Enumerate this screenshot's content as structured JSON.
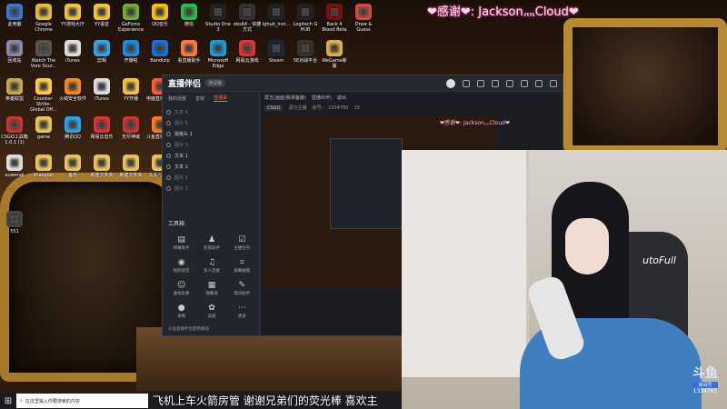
{
  "banner": {
    "text": "❤感谢❤: Jackson灬Cloud❤"
  },
  "sub_banner": {
    "text": "❤感谢❤: Jackson灬Cloud❤"
  },
  "desktop_icons": [
    {
      "label": "此电脑",
      "icon": "computer-icon",
      "color": "#3a78c9"
    },
    {
      "label": "Google Chrome",
      "icon": "chrome-icon",
      "color": "#e8b93a"
    },
    {
      "label": "YY游戏大厅",
      "icon": "yy-game-icon",
      "color": "#f6c23c"
    },
    {
      "label": "YY语音",
      "icon": "yy-voice-icon",
      "color": "#f6c23c"
    },
    {
      "label": "GeForce Experience",
      "icon": "nvidia-icon",
      "color": "#6fb02a"
    },
    {
      "label": "QQ音乐",
      "icon": "qq-music-icon",
      "color": "#f5c400"
    },
    {
      "label": "微信",
      "icon": "wechat-icon",
      "color": "#2fb84b"
    },
    {
      "label": "Studio One 3",
      "icon": "studio-one-icon",
      "color": "#222"
    },
    {
      "label": "obs64 - 快捷方式",
      "icon": "obs-icon",
      "color": "#333"
    },
    {
      "label": "lghub_inst...",
      "icon": "lghub-icon",
      "color": "#222"
    },
    {
      "label": "Logitech G HUB",
      "icon": "logitech-icon",
      "color": "#222"
    },
    {
      "label": "Back 4 Blood Beta",
      "icon": "b4b-icon",
      "color": "#7a1010"
    },
    {
      "label": "Draw & Guess",
      "icon": "draw-guess-icon",
      "color": "#c94d3a"
    },
    {
      "label": "回收站",
      "icon": "recycle-bin-icon",
      "color": "#88a"
    },
    {
      "label": "Watch The Vore Sour...",
      "icon": "game-icon",
      "color": "#555"
    },
    {
      "label": "iTunes",
      "icon": "itunes-icon",
      "color": "#ddd"
    },
    {
      "label": "剪辑",
      "icon": "edit-icon",
      "color": "#3aa0e8"
    },
    {
      "label": "开播啦",
      "icon": "live-icon",
      "color": "#1f8ae0"
    },
    {
      "label": "Bandizip",
      "icon": "bandizip-icon",
      "color": "#1e6fd0"
    },
    {
      "label": "看直播助手",
      "icon": "watch-icon",
      "color": "#ff7a3a"
    },
    {
      "label": "Microsoft Edge",
      "icon": "edge-icon",
      "color": "#1f9ad6"
    },
    {
      "label": "网易云游戏",
      "icon": "netease-icon",
      "color": "#d93535"
    },
    {
      "label": "Steam",
      "icon": "steam-icon",
      "color": "#1b2838"
    },
    {
      "label": "5E对战平台",
      "icon": "5e-icon",
      "color": "#333"
    },
    {
      "label": "WeGame新版",
      "icon": "wegame-icon",
      "color": "#d8b04a"
    },
    {
      "label": "英雄联盟",
      "icon": "lol-icon",
      "color": "#c8a848"
    },
    {
      "label": "Counter-Strike: Global Off...",
      "icon": "csgo-icon",
      "color": "#ffcc44"
    },
    {
      "label": "火绒安全软件",
      "icon": "huorong-icon",
      "color": "#f08a24"
    },
    {
      "label": "iTunes",
      "icon": "itunes-icon",
      "color": "#ddd"
    },
    {
      "label": "YY开播",
      "icon": "yy-live-icon",
      "color": "#f6c23c"
    },
    {
      "label": "电脑直播助手",
      "icon": "pc-live-icon",
      "color": "#ff5a3a"
    },
    {
      "label": "CSGO工具箱 1.0.1 (1)",
      "icon": "csgo-tool-icon",
      "color": "#c33"
    },
    {
      "label": "game",
      "icon": "folder-icon",
      "color": "#e6c35a"
    },
    {
      "label": "腾讯QQ",
      "icon": "qq-icon",
      "color": "#2aa3ef"
    },
    {
      "label": "网易云音乐",
      "icon": "netease-music-icon",
      "color": "#d93535"
    },
    {
      "label": "无尽神域",
      "icon": "game2-icon",
      "color": "#c33"
    },
    {
      "label": "斗鱼直播伴侣",
      "icon": "douyu-icon",
      "color": "#ff7a20"
    },
    {
      "label": "auwenqi",
      "icon": "file-icon",
      "color": "#ddd"
    },
    {
      "label": "zhaopian",
      "icon": "folder-icon",
      "color": "#e6c35a"
    },
    {
      "label": "备份",
      "icon": "folder-icon",
      "color": "#e6c35a"
    },
    {
      "label": "新建文件夹",
      "icon": "folder-icon",
      "color": "#e6c35a"
    },
    {
      "label": "新建文件夹",
      "icon": "folder-icon",
      "color": "#e6c35a"
    },
    {
      "label": "文本与资源",
      "icon": "folder-icon",
      "color": "#e6c35a"
    },
    {
      "label": "551",
      "icon": "file-icon",
      "color": "#444"
    }
  ],
  "app": {
    "title": "直播伴侣",
    "version": "测试版",
    "left_tabs": [
      "我的场景",
      "音效",
      "直播桌"
    ],
    "sources": [
      {
        "label": "文本 4",
        "visible": false
      },
      {
        "label": "图片 5",
        "visible": false
      },
      {
        "label": "摄像头 1",
        "visible": true
      },
      {
        "label": "图片 3",
        "visible": false
      },
      {
        "label": "文本 1",
        "visible": true
      },
      {
        "label": "文本 2",
        "visible": true
      },
      {
        "label": "图片 2",
        "visible": false
      },
      {
        "label": "图片 1",
        "visible": false
      }
    ],
    "toolbox_title": "工具箱",
    "tools": [
      {
        "label": "弹幕助手",
        "icon": "barrage-icon"
      },
      {
        "label": "房管助手",
        "icon": "admin-icon"
      },
      {
        "label": "主播任务",
        "icon": "task-icon"
      },
      {
        "label": "视频语音",
        "icon": "video-call-icon"
      },
      {
        "label": "多人连麦",
        "icon": "multi-call-icon"
      },
      {
        "label": "屏幕截图",
        "icon": "screenshot-icon"
      },
      {
        "label": "虚拟形象",
        "icon": "avatar-icon"
      },
      {
        "label": "弹幕墙",
        "icon": "wall-icon"
      },
      {
        "label": "歌词助手",
        "icon": "lyrics-icon"
      },
      {
        "label": "录制",
        "icon": "record-icon"
      },
      {
        "label": "美颜",
        "icon": "beauty-icon"
      },
      {
        "label": "更多",
        "icon": "more-icon"
      }
    ],
    "notice": "斗鱼直播伴侣使用教程",
    "right_tabs": [
      "屏五(画面)我准备撤)",
      "直播伙伴)",
      "退出"
    ],
    "info": {
      "category": "CSGO",
      "tag": "清分主播",
      "room_label": "房号:",
      "room_id": "1334765",
      "online": "13"
    },
    "bottom_actions": [
      {
        "label": "直播屏幕",
        "icon": "screen-icon"
      },
      {
        "label": "摄像头",
        "icon": "camera-icon"
      },
      {
        "label": "手机投屏",
        "icon": "phone-icon"
      },
      {
        "label": "多媒体",
        "icon": "media-icon"
      }
    ]
  },
  "webcam": {
    "chair_brand": "utoFull",
    "logo": "斗鱼",
    "logo_sub": "房间号",
    "room_id": "1334765"
  },
  "taskbar": {
    "search_placeholder": "在这里输入你要搜索的内容",
    "marquee": "飞机上车火箭房管 谢谢兄弟们的荧光棒 喜欢主"
  }
}
